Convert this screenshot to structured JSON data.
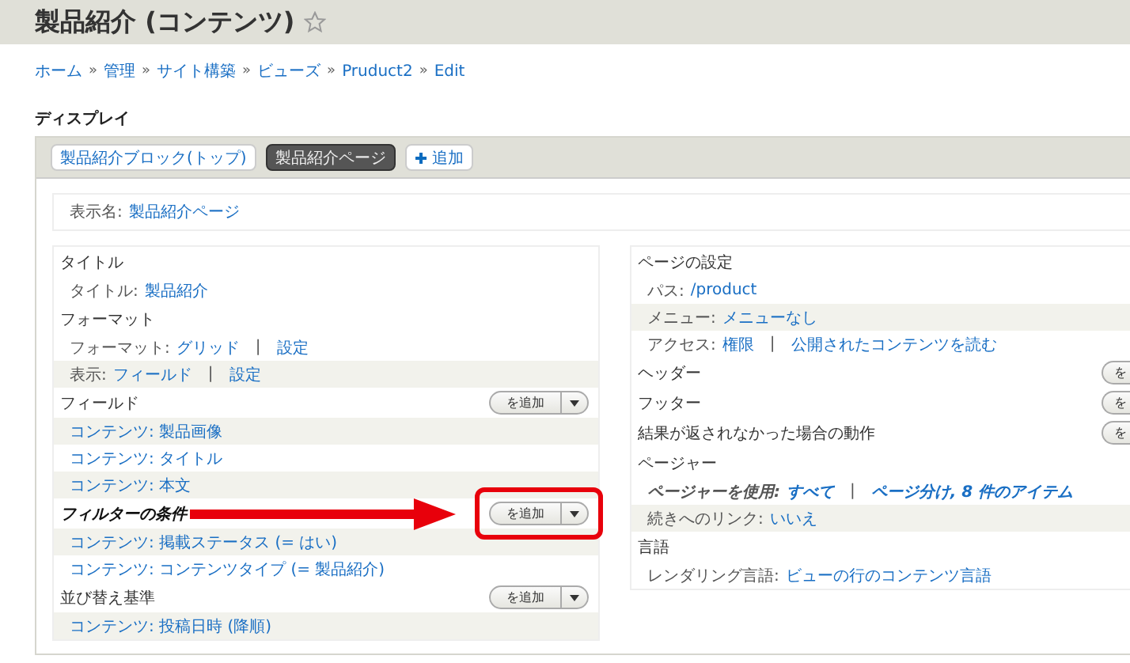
{
  "page_title": "製品紹介 (コンテンツ)",
  "breadcrumb": {
    "separator": "»",
    "items": [
      "ホーム",
      "管理",
      "サイト構築",
      "ビューズ",
      "Pruduct2",
      "Edit"
    ]
  },
  "displays": {
    "heading": "ディスプレイ",
    "tabs": [
      {
        "label": "製品紹介ブロック(トップ)",
        "selected": false
      },
      {
        "label": "製品紹介ページ",
        "selected": true
      }
    ],
    "add_button": "追加"
  },
  "display_name": {
    "label": "表示名:",
    "value": "製品紹介ページ"
  },
  "left_sections": [
    {
      "title": "タイトル",
      "emphasis": false,
      "rows": [
        {
          "label": "タイトル:",
          "links": [
            "製品紹介"
          ],
          "shaded": false
        }
      ]
    },
    {
      "title": "フォーマット",
      "emphasis": false,
      "rows": [
        {
          "label": "フォーマット:",
          "links": [
            "グリッド",
            "設定"
          ],
          "separator": "|",
          "shaded": false
        },
        {
          "label": "表示:",
          "links": [
            "フィールド",
            "設定"
          ],
          "separator": "|",
          "shaded": true
        }
      ]
    },
    {
      "title": "フィールド",
      "emphasis": false,
      "button": {
        "label": "を追加",
        "cut": false,
        "highlighted": false
      },
      "rows": [
        {
          "links": [
            "コンテンツ: 製品画像"
          ],
          "shaded": true
        },
        {
          "links": [
            "コンテンツ: タイトル"
          ],
          "shaded": false
        },
        {
          "links": [
            "コンテンツ: 本文"
          ],
          "shaded": true
        }
      ]
    },
    {
      "title": "フィルターの条件",
      "emphasis": true,
      "button": {
        "label": "を追加",
        "cut": false,
        "highlighted": true
      },
      "rows": [
        {
          "links": [
            "コンテンツ: 掲載ステータス (= はい)"
          ],
          "shaded": true
        },
        {
          "links": [
            "コンテンツ: コンテンツタイプ (= 製品紹介)"
          ],
          "shaded": false
        }
      ]
    },
    {
      "title": "並び替え基準",
      "emphasis": false,
      "button": {
        "label": "を追加",
        "cut": false,
        "highlighted": false
      },
      "rows": [
        {
          "links": [
            "コンテンツ: 投稿日時 (降順)"
          ],
          "shaded": true
        }
      ]
    }
  ],
  "right_sections": [
    {
      "title": "ページの設定",
      "emphasis": false,
      "rows": [
        {
          "label": "パス:",
          "links": [
            "/product"
          ],
          "shaded": false
        },
        {
          "label": "メニュー:",
          "links": [
            "メニューなし"
          ],
          "shaded": true
        },
        {
          "label": "アクセス:",
          "links": [
            "権限",
            "公開されたコンテンツを読む"
          ],
          "separator": "|",
          "shaded": false
        }
      ]
    },
    {
      "title": "ヘッダー",
      "emphasis": false,
      "button": {
        "label": "を",
        "cut": true,
        "highlighted": false
      }
    },
    {
      "title": "フッター",
      "emphasis": false,
      "button": {
        "label": "を",
        "cut": true,
        "highlighted": false
      }
    },
    {
      "title": "結果が返されなかった場合の動作",
      "emphasis": false,
      "button": {
        "label": "を",
        "cut": true,
        "highlighted": false
      }
    },
    {
      "title": "ページャー",
      "emphasis": false,
      "rows": [
        {
          "label": "ページャーを使用:",
          "links": [
            "すべて",
            "ページ分け, 8 件のアイテム"
          ],
          "separator": "|",
          "shaded": false,
          "italic": true
        },
        {
          "label": "続きへのリンク:",
          "links": [
            "いいえ"
          ],
          "shaded": true
        }
      ]
    },
    {
      "title": "言語",
      "emphasis": false,
      "rows": [
        {
          "label": "レンダリング言語:",
          "links": [
            "ビューの行のコンテンツ言語"
          ],
          "shaded": false
        }
      ]
    }
  ]
}
